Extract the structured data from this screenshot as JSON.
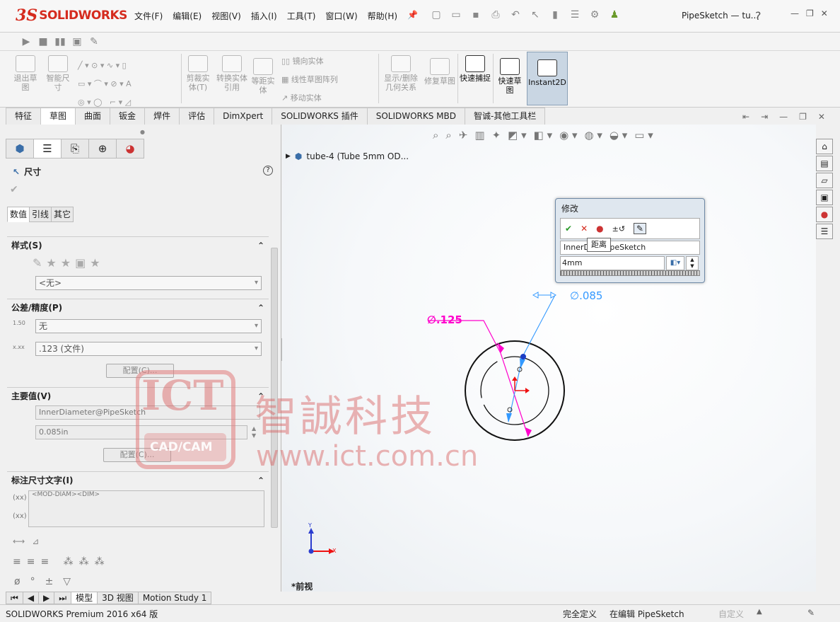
{
  "app": {
    "logo_ds": "3S",
    "logo_text": "SOLIDWORKS",
    "title": "PipeSketch — tu...",
    "help": "?"
  },
  "menus": [
    "文件(F)",
    "编辑(E)",
    "视图(V)",
    "插入(I)",
    "工具(T)",
    "窗口(W)",
    "帮助(H)"
  ],
  "command_manager": {
    "exit_sketch": "退出草图",
    "smart_dim": "智能尺寸",
    "trim": "剪裁实体(T)",
    "convert": "转换实体引用",
    "offset": "等距实体",
    "mirror": "镜向实体",
    "linear_pattern": "线性草图阵列",
    "move": "移动实体",
    "display_relations": "显示/删除几何关系",
    "repair": "修复草图",
    "quick_snap": "快速捕捉",
    "rapid_sketch": "快速草图",
    "instant2d": "Instant2D"
  },
  "tabs": [
    "特征",
    "草图",
    "曲面",
    "钣金",
    "焊件",
    "评估",
    "DimXpert",
    "SOLIDWORKS 插件",
    "SOLIDWORKS MBD",
    "智诚-其他工具栏"
  ],
  "property_manager": {
    "title": "尺寸",
    "sub_tabs": [
      "数值",
      "引线",
      "其它"
    ],
    "style": {
      "header": "样式(S)",
      "combo": "<无>"
    },
    "tolerance": {
      "header": "公差/精度(P)",
      "tol_icon": "1.50",
      "tol_combo": "无",
      "prec_combo": ".123 (文件)",
      "config_button": "配置(C)..."
    },
    "primary": {
      "header": "主要值(V)",
      "name": "InnerDiameter@PipeSketch",
      "value": "0.085in",
      "config_button": "配置(C)..."
    },
    "dim_text": {
      "header": "标注尺寸文字(I)",
      "content": "<MOD-DIAM><DIM>"
    }
  },
  "graphics": {
    "tree_node": "tube-4  (Tube 5mm OD...",
    "dim_outer": "∅.125",
    "dim_inner": "∅.085",
    "view_label": "*前视",
    "axis_x": "X",
    "axis_y": "Y"
  },
  "modify_dialog": {
    "title": "修改",
    "name_field": "InnerD       r@PipeSketch",
    "tooltip": "距离",
    "input_value": "4mm"
  },
  "bottom_tabs": [
    "模型",
    "3D 视图",
    "Motion Study 1"
  ],
  "status": {
    "product": "SOLIDWORKS Premium 2016 x64 版",
    "defined": "完全定义",
    "editing": "在编辑 PipeSketch",
    "custom": "自定义"
  },
  "watermark": {
    "ict": "ICT",
    "cadcam": "CAD/CAM",
    "cn_name": "智誠科技",
    "url": "www.ict.com.cn"
  },
  "colors": {
    "brand_red": "#d52b1e",
    "dim_magenta": "#ff00cc",
    "dim_blue": "#3399ff",
    "sketch_black": "#111111"
  }
}
